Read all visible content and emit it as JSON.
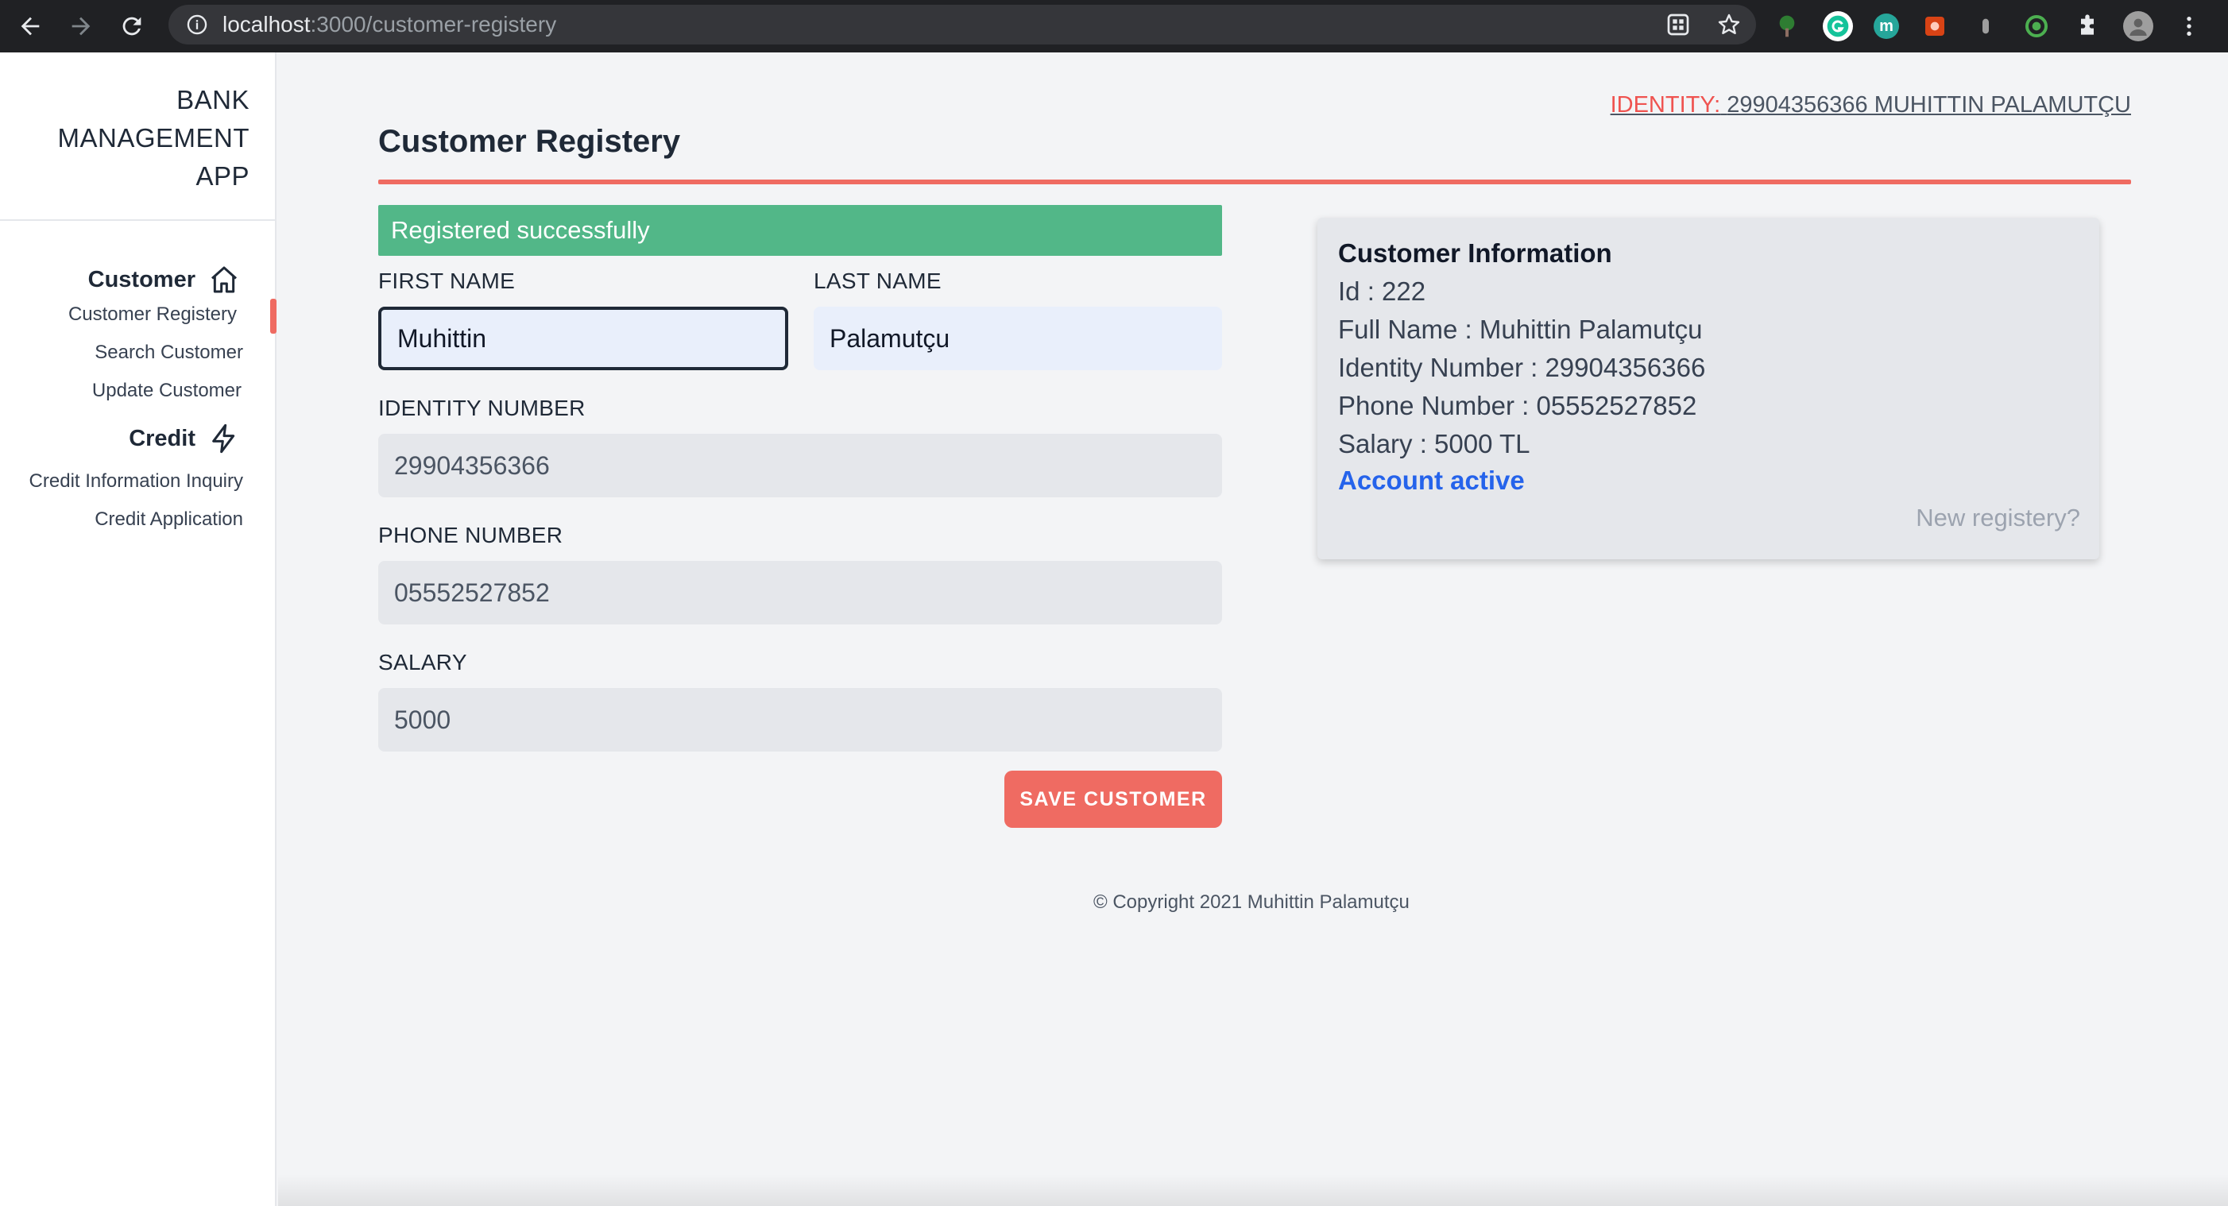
{
  "browser": {
    "url_host": "localhost",
    "url_path": ":3000/customer-registery",
    "icons": [
      "back-icon",
      "forward-icon",
      "reload-icon",
      "info-icon",
      "apps-icon",
      "star-icon",
      "extension-tree-icon",
      "grammarly-icon",
      "extension-m-icon",
      "extension-red-icon",
      "extension-gray-icon",
      "extension-green-icon",
      "puzzle-icon",
      "profile-icon",
      "menu-icon"
    ]
  },
  "sidebar": {
    "brand": [
      "BANK",
      "MANAGEMENT",
      "APP"
    ],
    "sections": [
      {
        "label": "Customer",
        "icon": "home-icon",
        "items": [
          "Customer Registery",
          "Search Customer",
          "Update Customer"
        ]
      },
      {
        "label": "Credit",
        "icon": "lightning-icon",
        "items": [
          "Credit Information Inquiry",
          "Credit Application"
        ]
      }
    ],
    "active_item": "Customer Registery"
  },
  "header": {
    "identity_label": "IDENTITY:",
    "identity_value": "29904356366 MUHITTIN PALAMUTÇU",
    "title": "Customer Registery"
  },
  "alert": {
    "message": "Registered successfully",
    "color": "#52b788"
  },
  "form": {
    "first_name": {
      "label": "FIRST NAME",
      "value": "Muhittin"
    },
    "last_name": {
      "label": "LAST NAME",
      "value": "Palamutçu"
    },
    "identity_number": {
      "label": "IDENTITY NUMBER",
      "value": "29904356366"
    },
    "phone_number": {
      "label": "PHONE NUMBER",
      "value": "05552527852"
    },
    "salary": {
      "label": "SALARY",
      "value": "5000"
    },
    "save_label": "SAVE CUSTOMER"
  },
  "info_card": {
    "title": "Customer Information",
    "lines": [
      "Id : 222",
      "Full Name : Muhittin Palamutçu",
      "Identity Number : 29904356366",
      "Phone Number : 05552527852",
      "Salary : 5000 TL"
    ],
    "status": "Account active",
    "new_link": "New registery?"
  },
  "footer": {
    "copyright": "© Copyright 2021 Muhittin Palamutçu"
  },
  "colors": {
    "accent": "#ef6b62",
    "success": "#52b788",
    "link": "#2563eb"
  }
}
